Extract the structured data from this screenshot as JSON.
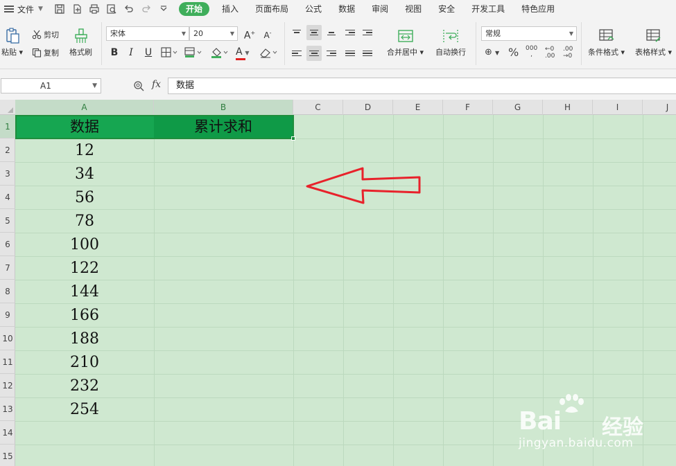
{
  "menubar": {
    "file_label": "文件",
    "tabs": [
      {
        "label": "开始",
        "active": true
      },
      {
        "label": "插入"
      },
      {
        "label": "页面布局"
      },
      {
        "label": "公式"
      },
      {
        "label": "数据"
      },
      {
        "label": "审阅"
      },
      {
        "label": "视图"
      },
      {
        "label": "安全"
      },
      {
        "label": "开发工具"
      },
      {
        "label": "特色应用"
      }
    ]
  },
  "ribbon": {
    "paste_label": "粘贴",
    "cut_label": "剪切",
    "copy_label": "复制",
    "format_painter_label": "格式刷",
    "font_name": "宋体",
    "font_size": "20",
    "bold": "B",
    "italic": "I",
    "underline": "U",
    "font_color_glyph": "A",
    "merge_center_label": "合并居中",
    "wrap_text_label": "自动换行",
    "number_format": "常规",
    "conditional_format_label": "条件格式",
    "table_style_label": "表格样式",
    "percent": "%",
    "accent_color": "#3fae5b"
  },
  "formula_bar": {
    "cell_ref": "A1",
    "fx": "fx",
    "content": "数据"
  },
  "sheet": {
    "columns": [
      "A",
      "B",
      "C",
      "D",
      "E",
      "F",
      "G",
      "H",
      "I",
      "J"
    ],
    "rows": [
      "1",
      "2",
      "3",
      "4",
      "5",
      "6",
      "7",
      "8",
      "9",
      "10",
      "11",
      "12",
      "13",
      "14",
      "15"
    ],
    "header_a": "数据",
    "header_b": "累计求和",
    "values": [
      "12",
      "34",
      "56",
      "78",
      "100",
      "122",
      "144",
      "166",
      "188",
      "210",
      "232",
      "254"
    ],
    "header_fill": "#16a651",
    "sheet_tint": "#cfe8d0",
    "arrow_color": "#e8222b"
  },
  "watermark": {
    "brand": "Bai",
    "brand_cn": "经验",
    "url": "jingyan.baidu.com"
  }
}
